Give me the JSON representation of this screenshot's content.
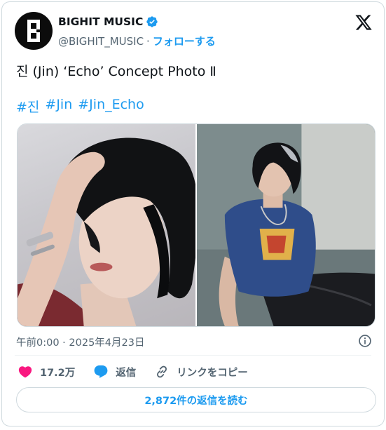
{
  "account": {
    "display_name": "BIGHIT MUSIC",
    "handle": "@BIGHIT_MUSIC",
    "separator": "·",
    "follow_label": "フォローする"
  },
  "tweet": {
    "text": "진 (Jin) ‘Echo’ Concept Photo Ⅱ",
    "hashtags": [
      "#진",
      "#Jin",
      "#Jin_Echo"
    ]
  },
  "media": {
    "photos": [
      "photo-1",
      "photo-2"
    ]
  },
  "timestamp": "午前0:00 · 2025年4月23日",
  "actions": {
    "like_count": "17.2万",
    "reply_label": "返信",
    "copy_link_label": "リンクをコピー"
  },
  "read_replies_label": "2,872件の返信を読む",
  "colors": {
    "accent": "#1d9bf0",
    "like": "#f91880",
    "muted": "#536471",
    "border": "#cfd9de"
  },
  "icons": [
    "bighit-logo-icon",
    "verified-badge-icon",
    "x-logo-icon",
    "info-icon",
    "heart-icon",
    "reply-icon",
    "link-icon"
  ]
}
